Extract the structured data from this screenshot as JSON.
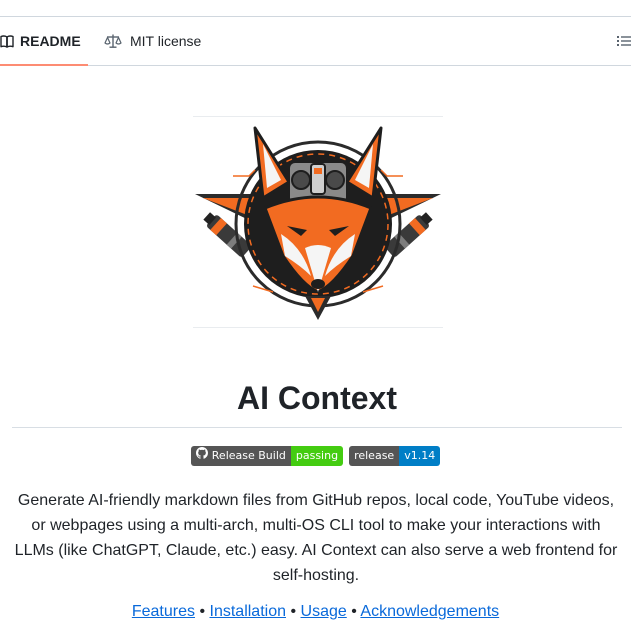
{
  "tabs": [
    {
      "label": "README",
      "icon": "book-icon",
      "active": true
    },
    {
      "label": "MIT license",
      "icon": "law-scale-icon",
      "active": false
    }
  ],
  "outline_icon": "list-unordered-icon",
  "logo": {
    "description_icon": "fox-logo"
  },
  "title": "AI Context",
  "badges": {
    "build": {
      "left": "Release Build",
      "right": "passing",
      "icon": "github-icon",
      "right_color": "#44cc11"
    },
    "release": {
      "left": "release",
      "right": "v1.14",
      "right_color": "#007ec6"
    }
  },
  "description": "Generate AI-friendly markdown files from GitHub repos, local code, YouTube videos, or webpages using a multi-arch, multi-OS CLI tool to make your interactions with LLMs (like ChatGPT, Claude, etc.) easy. AI Context can also serve a web frontend for self-hosting.",
  "links": [
    {
      "label": "Features"
    },
    {
      "label": "Installation"
    },
    {
      "label": "Usage"
    },
    {
      "label": "Acknowledgements"
    }
  ],
  "link_separator": "•",
  "colors": {
    "tab_underline": "#fd8c73",
    "link": "#0969da",
    "fox_orange": "#f26b21",
    "badge_dark": "#555555"
  }
}
